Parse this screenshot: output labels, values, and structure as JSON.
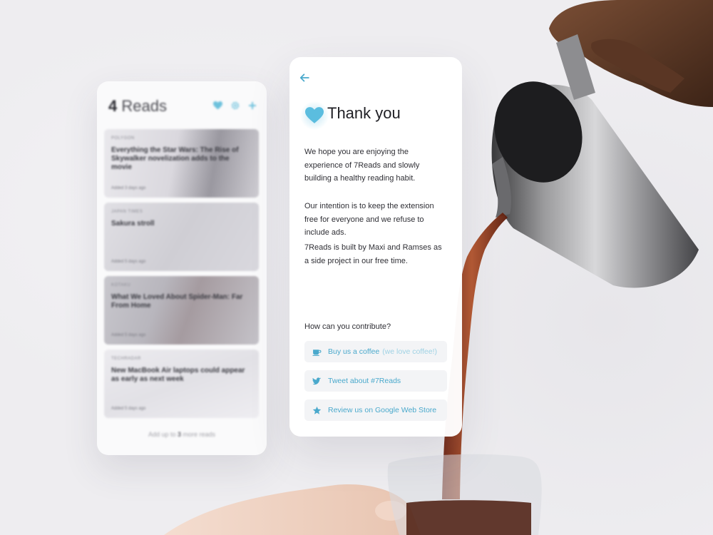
{
  "colors": {
    "accent": "#4aa9cc",
    "accent_light": "#9fd2e4",
    "heart": "#5bbddf"
  },
  "back_panel": {
    "count": "4",
    "title": "Reads",
    "actions": [
      "heart-icon",
      "gear-icon",
      "plus-icon"
    ],
    "reads": [
      {
        "source": "POLYGON",
        "title": "Everything the Star Wars: The Rise of Skywalker novelization adds to the movie",
        "added": "Added 3 days ago"
      },
      {
        "source": "JAPAN TIMES",
        "title": "Sakura stroll",
        "added": "Added 5 days ago"
      },
      {
        "source": "KOTAKU",
        "title": "What We Loved About Spider-Man: Far From Home",
        "added": "Added 5 days ago"
      },
      {
        "source": "TECHRADAR",
        "title": "New MacBook Air laptops could appear as early as next week",
        "added": "Added 5 days ago"
      }
    ],
    "footer_pre": "Add up to ",
    "footer_num": "3",
    "footer_post": " more reads"
  },
  "thanks": {
    "back_icon": "arrow-left-icon",
    "title": "Thank you",
    "paragraphs": [
      "We hope you are enjoying the experience of 7Reads and slowly building a healthy reading habit.",
      "Our intention is to keep the extension free for everyone and we refuse to include ads.",
      "7Reads is built by Maxi and Ramses as a side project in our free time."
    ],
    "question": "How can you contribute?",
    "actions": [
      {
        "icon": "coffee-cup-icon",
        "label": "Buy us a coffee",
        "note": "(we love coffee!)"
      },
      {
        "icon": "twitter-icon",
        "label": "Tweet about #7Reads"
      },
      {
        "icon": "star-icon",
        "label": "Review us on Google Web Store"
      }
    ]
  }
}
